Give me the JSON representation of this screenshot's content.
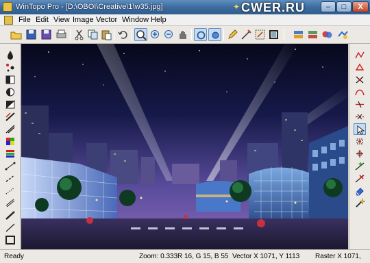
{
  "window": {
    "app_title": "WinTopo Pro - [D:\\OBOI\\Creative\\1\\w35.jpg]",
    "watermark": "CWER.RU",
    "minimize": "–",
    "maximize": "□",
    "close": "X"
  },
  "menu": [
    "File",
    "Edit",
    "View",
    "Image",
    "Vector",
    "Window",
    "Help"
  ],
  "toolbar": {
    "icons": [
      "open-folder-icon",
      "save-icon",
      "save-as-icon",
      "print-icon",
      "cut-icon",
      "copy-icon",
      "paste-icon",
      "undo-icon",
      "zoom-window-icon",
      "zoom-in-icon",
      "zoom-out-icon",
      "pan-hand-icon",
      "select-round-icon",
      "select-circle-icon",
      "pencil-icon",
      "line-pen-icon",
      "edit-region-icon",
      "crop-icon",
      "raster-layers-icon",
      "vector-layers-icon",
      "merge-icon",
      "convert-icon"
    ],
    "active": [
      "zoom-window-icon",
      "select-round-icon",
      "select-circle-icon"
    ]
  },
  "left_tools": [
    "fill-drop-icon",
    "dots-icon",
    "contrast-half-icon",
    "contrast-full-icon",
    "black-white-icon",
    "slash-filter-icon",
    "diagonal-filter-icon",
    "color-palette-icon",
    "color-bars-icon",
    "thin-line-icon",
    "dash-line-icon",
    "dot-line-icon",
    "double-line-icon",
    "stroke-line-icon",
    "line-tool-icon",
    "rectangle-icon"
  ],
  "right_tools": [
    "polyline-icon",
    "polygon-icon",
    "cross-node-icon",
    "curve-icon",
    "split-icon",
    "join-icon",
    "cursor-select-icon",
    "node-select-icon",
    "snap-icon",
    "node-add-icon",
    "node-delete-icon",
    "eraser-icon",
    "magic-select-icon"
  ],
  "status": {
    "ready": "Ready",
    "zoom": "Zoom: 0.333",
    "color": "R 16, G 15, B 55",
    "vector": "Vector  X 1071, Y 1113",
    "raster": "Raster  X 1071, "
  },
  "colors": {
    "title_bar": "#3d6c9e",
    "sky_top": "#08091f",
    "sky_bottom": "#7b5fb6",
    "accent_select": "#5c8cc4"
  }
}
